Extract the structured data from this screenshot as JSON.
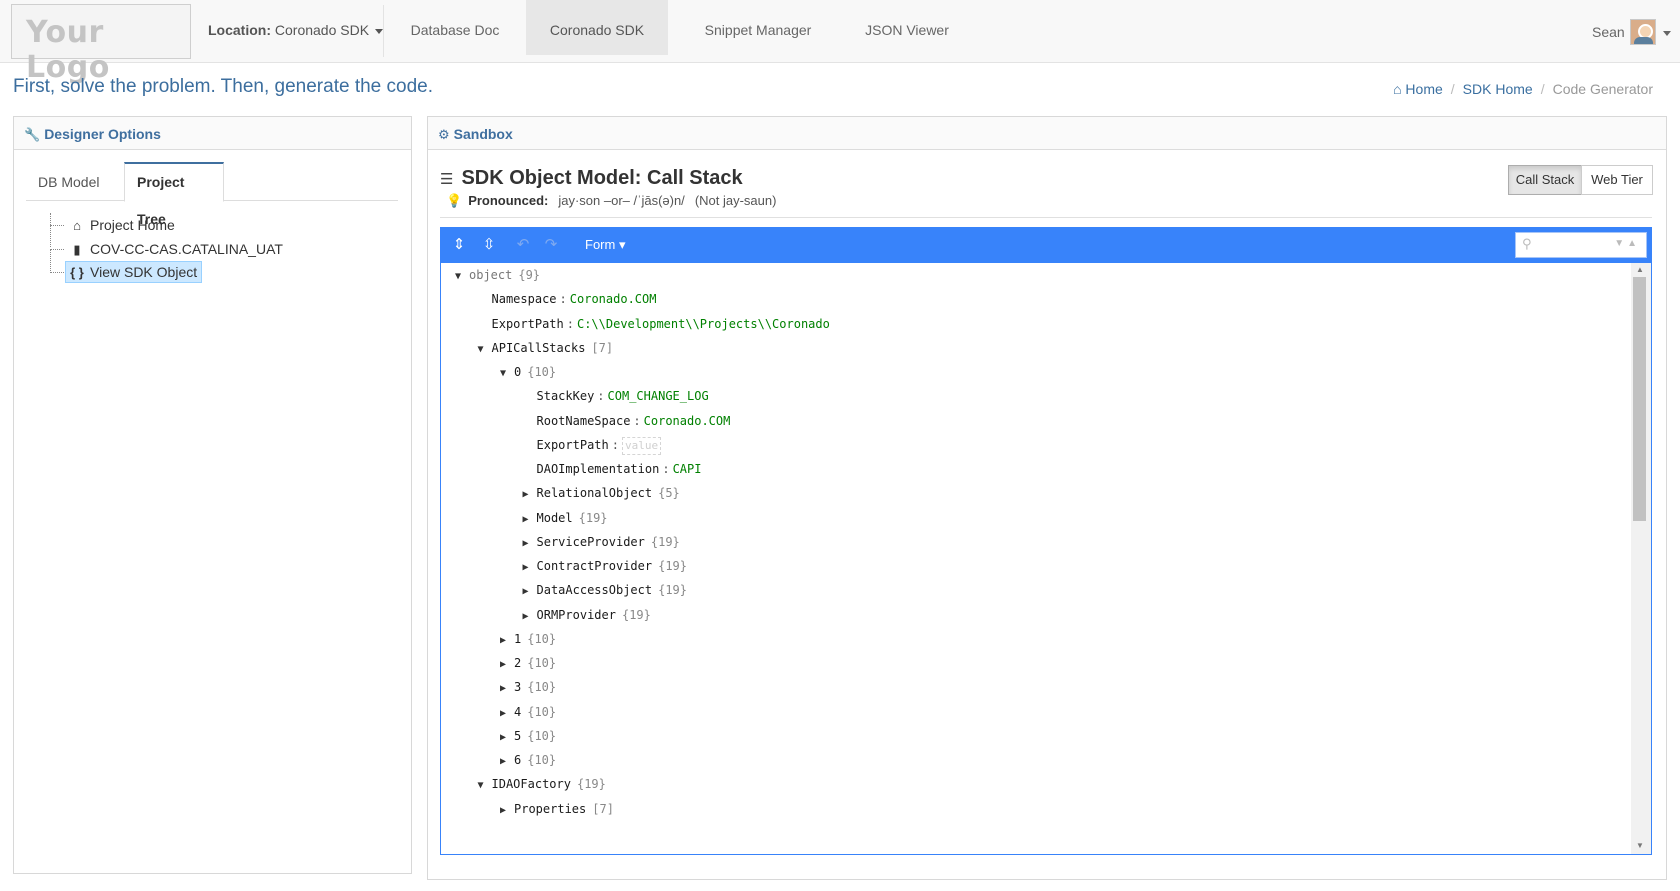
{
  "navbar": {
    "logo_text": "Your Logo",
    "location_label": "Location:",
    "location_value": "Coronado SDK",
    "tabs": [
      {
        "label": "Database Doc"
      },
      {
        "label": "Coronado SDK"
      },
      {
        "label": "Snippet Manager"
      },
      {
        "label": "JSON Viewer"
      }
    ],
    "user_name": "Sean"
  },
  "header": {
    "tagline": "First, solve the problem. Then, generate the code.",
    "breadcrumb": {
      "home": "Home",
      "sdk_home": "SDK Home",
      "current": "Code Generator"
    }
  },
  "designer": {
    "title": "Designer Options",
    "tabs": [
      {
        "label": "DB Model"
      },
      {
        "label": "Project Tree"
      }
    ],
    "tree": [
      {
        "label": "Project Home",
        "icon": "home-icon"
      },
      {
        "label": "COV-CC-CAS.CATALINA_UAT",
        "icon": "database-icon"
      },
      {
        "label": "View SDK Object",
        "icon": "braces-icon"
      }
    ]
  },
  "sandbox": {
    "title": "Sandbox",
    "model_title": "SDK Object Model: Call Stack",
    "pronounced_label": "Pronounced:",
    "pronounced_value": "jay·son –or– /ˈjās(ə)n/",
    "pronounced_note": "(Not jay-saun)",
    "buttons": {
      "call_stack": "Call Stack",
      "web_tier": "Web Tier"
    }
  },
  "editor": {
    "mode_label": "Form ▾",
    "rows": [
      {
        "key": "object",
        "count": "{9}",
        "toggle": "▼"
      },
      {
        "key": "Namespace",
        "value": "Coronado.COM"
      },
      {
        "key": "ExportPath",
        "value": "C:\\\\Development\\\\Projects\\\\Coronado"
      },
      {
        "key": "APICallStacks",
        "count": "[7]",
        "toggle": "▼"
      },
      {
        "key": "0",
        "count": "{10}",
        "toggle": "▼"
      },
      {
        "key": "StackKey",
        "value": "COM_CHANGE_LOG"
      },
      {
        "key": "RootNameSpace",
        "value": "Coronado.COM"
      },
      {
        "key": "ExportPath",
        "placeholder": "value"
      },
      {
        "key": "DAOImplementation",
        "value": "CAPI"
      },
      {
        "key": "RelationalObject",
        "count": "{5}",
        "toggle": "▶"
      },
      {
        "key": "Model",
        "count": "{19}",
        "toggle": "▶"
      },
      {
        "key": "ServiceProvider",
        "count": "{19}",
        "toggle": "▶"
      },
      {
        "key": "ContractProvider",
        "count": "{19}",
        "toggle": "▶"
      },
      {
        "key": "DataAccessObject",
        "count": "{19}",
        "toggle": "▶"
      },
      {
        "key": "ORMProvider",
        "count": "{19}",
        "toggle": "▶"
      },
      {
        "key": "1",
        "count": "{10}",
        "toggle": "▶"
      },
      {
        "key": "2",
        "count": "{10}",
        "toggle": "▶"
      },
      {
        "key": "3",
        "count": "{10}",
        "toggle": "▶"
      },
      {
        "key": "4",
        "count": "{10}",
        "toggle": "▶"
      },
      {
        "key": "5",
        "count": "{10}",
        "toggle": "▶"
      },
      {
        "key": "6",
        "count": "{10}",
        "toggle": "▶"
      },
      {
        "key": "IDAOFactory",
        "count": "{19}",
        "toggle": "▼"
      },
      {
        "key": "Properties",
        "count": "[7]",
        "toggle": "▶"
      }
    ]
  },
  "colors": {
    "accent": "#3883fa",
    "link": "#3f6f9f",
    "value_green": "#008000"
  }
}
